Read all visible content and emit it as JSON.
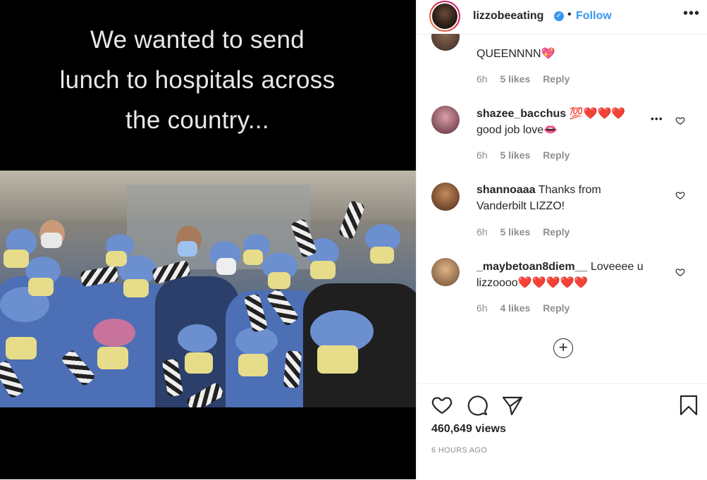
{
  "media": {
    "caption_lines": [
      "We wanted to send",
      "lunch to hospitals across",
      "the country..."
    ]
  },
  "header": {
    "username": "lizzobeeating",
    "separator": "•",
    "follow_label": "Follow",
    "more_icon": "more-horizontal-icon"
  },
  "comments": [
    {
      "username": "",
      "text": "QUEENNNN💖",
      "age": "6h",
      "likes": "5 likes",
      "reply": "Reply"
    },
    {
      "username": "shazee_bacchus",
      "text": "💯❤️❤️❤️ good job love👄",
      "age": "6h",
      "likes": "5 likes",
      "reply": "Reply"
    },
    {
      "username": "shannoaaa",
      "text": "Thanks from Vanderbilt LIZZO!",
      "age": "6h",
      "likes": "5 likes",
      "reply": "Reply"
    },
    {
      "username": "_maybetoan8diem__",
      "text": "Loveeee u lizzoooo❤️❤️❤️❤️❤️",
      "age": "6h",
      "likes": "4 likes",
      "reply": "Reply"
    }
  ],
  "load_more_icon": "plus-circle-icon",
  "actions": {
    "views": "460,649 views",
    "time": "6 HOURS AGO"
  },
  "colors": {
    "accent": "#3897f0",
    "muted": "#8e8e8e",
    "text": "#262626"
  }
}
